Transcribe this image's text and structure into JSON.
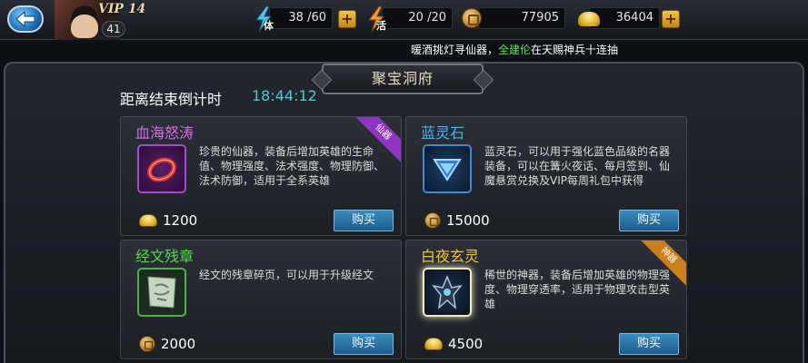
{
  "topbar": {
    "vip": "VIP 14",
    "level": "41",
    "stamina": {
      "tag": "体",
      "value": "38 /60"
    },
    "vitality": {
      "tag": "活",
      "value": "20 /20"
    },
    "coins": {
      "value": "77905"
    },
    "ingots": {
      "value": "36404"
    },
    "plus_label": "+"
  },
  "marquee": {
    "before": "暖酒挑灯寻仙器，",
    "highlight": "全建伦",
    "after": "在天赐神兵十连抽"
  },
  "panel": {
    "title": "聚宝洞府",
    "countdown_label": "距离结束倒计时",
    "countdown_time": "18:44:12"
  },
  "items": [
    {
      "name": "血海怒涛",
      "name_color": "#d86ae6",
      "badge": "仙器",
      "badge_color": "#8e35c4",
      "icon": "red-ring-icon",
      "desc": "珍贵的仙器，装备后增加英雄的生命值、物理强度、法术强度、物理防御、法术防御，适用于全系英雄",
      "price": "1200",
      "currency": "ingot",
      "buy_label": "购买"
    },
    {
      "name": "蓝灵石",
      "name_color": "#4fb4f0",
      "badge": "",
      "icon": "blue-gem-icon",
      "desc": "蓝灵石，可以用于强化蓝色品级的名器装备，可以在篝火夜话、每月签到、仙魔悬赏兑换及VIP每周礼包中获得",
      "price": "15000",
      "currency": "coin",
      "buy_label": "购买"
    },
    {
      "name": "经文残章",
      "name_color": "#57d94c",
      "badge": "",
      "icon": "scripture-scroll-icon",
      "desc": "经文的残章碎页，可以用于升级经文",
      "price": "2000",
      "currency": "coin",
      "buy_label": "购买"
    },
    {
      "name": "白夜玄灵",
      "name_color": "#f0c43a",
      "badge": "神器",
      "badge_color": "#c9801c",
      "icon": "dark-spirit-weapon-icon",
      "desc": "稀世的神器，装备后增加英雄的物理强度、物理穿透率，适用于物理攻击型英雄",
      "price": "4500",
      "currency": "ingot",
      "buy_label": "购买"
    }
  ]
}
